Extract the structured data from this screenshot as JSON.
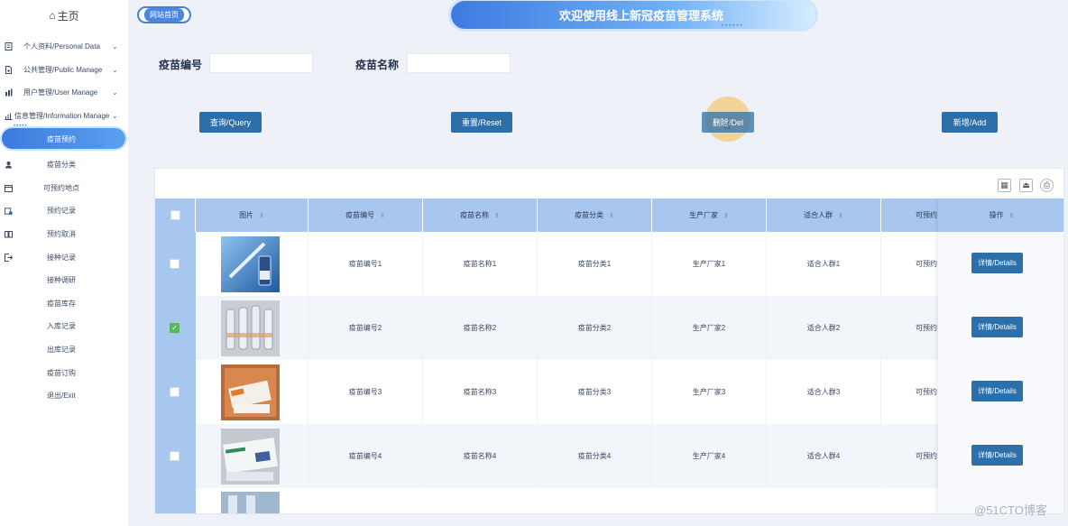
{
  "sidebar": {
    "home": "主页",
    "items": [
      {
        "label": "个人资料/Personal Data",
        "icon": "id-card-icon",
        "chevron": "⌄"
      },
      {
        "label": "公共管理/Public Manage",
        "icon": "document-icon",
        "chevron": "⌄"
      },
      {
        "label": "用户管理/User Manage",
        "icon": "users-icon",
        "chevron": "⌄"
      },
      {
        "label": "信息管理/Information Manage",
        "icon": "chart-icon",
        "chevron": "⌄"
      }
    ],
    "active_item": "疫苗预约",
    "sub_items": [
      {
        "label": "疫苗分类",
        "icon": "person-icon"
      },
      {
        "label": "可预约地点",
        "icon": "calendar-icon"
      },
      {
        "label": "预约记录",
        "icon": "calendar-check-icon"
      },
      {
        "label": "预约取消",
        "icon": "book-icon"
      },
      {
        "label": "接种记录",
        "icon": "logout-icon"
      },
      {
        "label": "接种调研",
        "icon": ""
      },
      {
        "label": "疫苗库存",
        "icon": ""
      },
      {
        "label": "入库记录",
        "icon": ""
      },
      {
        "label": "出库记录",
        "icon": ""
      },
      {
        "label": "疫苗订购",
        "icon": ""
      },
      {
        "label": "退出/Exit",
        "icon": ""
      }
    ]
  },
  "header": {
    "breadcrumb": "网站首页",
    "title": "欢迎使用线上新冠疫苗管理系统"
  },
  "search": {
    "code_label": "疫苗编号",
    "code_value": "",
    "name_label": "疫苗名称",
    "name_value": ""
  },
  "buttons": {
    "query": "查询/Query",
    "reset": "重置/Reset",
    "delete": "删除/Del",
    "add": "新增/Add"
  },
  "toolbar": [
    "columns-icon",
    "export-icon",
    "print-icon"
  ],
  "table": {
    "columns": [
      "图片",
      "疫苗编号",
      "疫苗名称",
      "疫苗分类",
      "生产厂家",
      "适合人群",
      "可预约",
      "操作"
    ],
    "rows": [
      {
        "code": "疫苗编号1",
        "name": "疫苗名称1",
        "category": "疫苗分类1",
        "maker": "生产厂家1",
        "group": "适合人群1",
        "avail": "可预约",
        "action": "详情/Details",
        "checked": false,
        "check_mark": ""
      },
      {
        "code": "疫苗编号2",
        "name": "疫苗名称2",
        "category": "疫苗分类2",
        "maker": "生产厂家2",
        "group": "适合人群2",
        "avail": "可预约",
        "action": "详情/Details",
        "checked": true,
        "check_mark": "✓"
      },
      {
        "code": "疫苗编号3",
        "name": "疫苗名称3",
        "category": "疫苗分类3",
        "maker": "生产厂家3",
        "group": "适合人群3",
        "avail": "可预约",
        "action": "详情/Details",
        "checked": false,
        "check_mark": ""
      },
      {
        "code": "疫苗编号4",
        "name": "疫苗名称4",
        "category": "疫苗分类4",
        "maker": "生产厂家4",
        "group": "适合人群4",
        "avail": "可预约",
        "action": "详情/Details",
        "checked": false,
        "check_mark": ""
      }
    ]
  },
  "watermark": "@51CTO博客",
  "colors": {
    "accent": "#2d6fa8",
    "header_bg": "#a8c7ee",
    "highlight": "#f5c878"
  }
}
